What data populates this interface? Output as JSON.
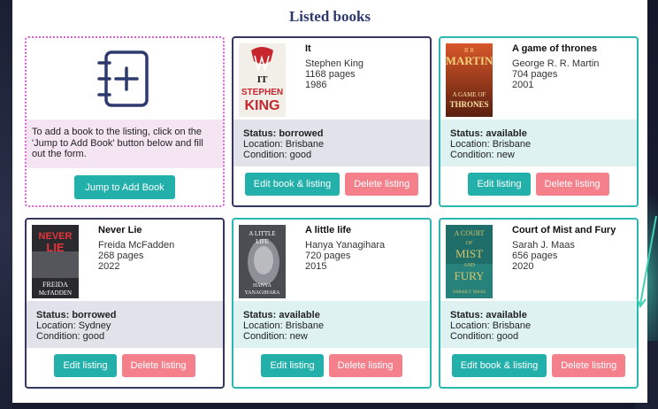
{
  "page": {
    "title": "Listed books"
  },
  "add_card": {
    "text": "To add a book to the listing, click on the 'Jump to Add Book' button below and fill out the form.",
    "button_label": "Jump to Add Book"
  },
  "books": [
    {
      "title": "It",
      "author": "Stephen King",
      "pages": "1168 pages",
      "year": "1986",
      "status": "Status: borrowed",
      "location": "Location: Brisbane",
      "condition": "Condition: good",
      "edit_label": "Edit book & listing",
      "delete_label": "Delete listing",
      "cover_text": [
        "IT",
        "STEPHEN",
        "KING"
      ]
    },
    {
      "title": "A game of thrones",
      "author": "George R. R. Martin",
      "pages": "704 pages",
      "year": "2001",
      "status": "Status: available",
      "location": "Location: Brisbane",
      "condition": "Condition: new",
      "edit_label": "Edit listing",
      "delete_label": "Delete listing",
      "cover_text": [
        "R R",
        "MARTIN",
        "A GAME OF",
        "THRONES"
      ]
    },
    {
      "title": "Never Lie",
      "author": "Freida McFadden",
      "pages": "268 pages",
      "year": "2022",
      "status": "Status: borrowed",
      "location": "Location: Sydney",
      "condition": "Condition: good",
      "edit_label": "Edit listing",
      "delete_label": "Delete listing",
      "cover_text": [
        "NEVER",
        "LIE",
        "FREIDA",
        "McFADDEN"
      ]
    },
    {
      "title": "A little life",
      "author": "Hanya Yanagihara",
      "pages": "720 pages",
      "year": "2015",
      "status": "Status: available",
      "location": "Location: Brisbane",
      "condition": "Condition: new",
      "edit_label": "Edit listing",
      "delete_label": "Delete listing",
      "cover_text": [
        "A LITTLE",
        "LIFE",
        "HANYA",
        "YANAGIHARA"
      ]
    },
    {
      "title": "Court of Mist and Fury",
      "author": "Sarah J. Maas",
      "pages": "656 pages",
      "year": "2020",
      "status": "Status: available",
      "location": "Location: Brisbane",
      "condition": "Condition: good",
      "edit_label": "Edit book & listing",
      "delete_label": "Delete listing",
      "cover_text": [
        "A COURT",
        "OF",
        "MIST",
        "AND",
        "FURY",
        "SARAH J. MAAS"
      ]
    }
  ],
  "colors": {
    "teal": "#23afaa",
    "pink": "#f4808c",
    "navy": "#34385e",
    "borrowed_bg": "#e2e3ea",
    "available_bg": "#ddf2f1",
    "add_bg": "#f5e5f3"
  }
}
